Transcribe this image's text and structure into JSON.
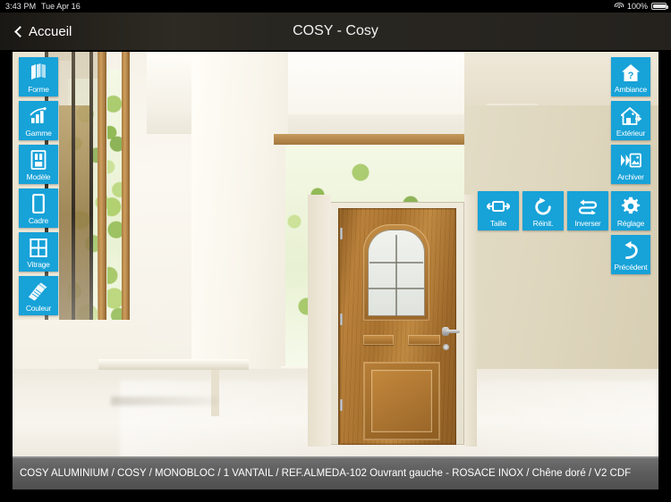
{
  "status_bar": {
    "time": "3:43 PM",
    "date": "Tue Apr 16",
    "battery_percent": "100%",
    "wifi_icon": "wifi-icon",
    "battery_icon": "battery-icon"
  },
  "nav_bar": {
    "back_label": "Accueil",
    "back_icon": "chevron-left-icon",
    "title": "COSY - Cosy"
  },
  "colors": {
    "accent": "#17a2d8",
    "navbar": "#3a372f",
    "infobar": "#5d5d5d"
  },
  "left_toolbar": [
    {
      "label": "Forme",
      "icon": "shapes-stack-icon"
    },
    {
      "label": "Gamme",
      "icon": "bar-chart-icon"
    },
    {
      "label": "Modèle",
      "icon": "door-model-icon"
    },
    {
      "label": "Cadre",
      "icon": "frame-icon"
    },
    {
      "label": "Vitrage",
      "icon": "window-grid-icon"
    },
    {
      "label": "Couleur",
      "icon": "paint-brush-icon"
    }
  ],
  "right_toolbar": [
    {
      "label": "Ambiance",
      "icon": "house-question-icon"
    },
    {
      "label": "Extérieur",
      "icon": "house-exterior-icon"
    },
    {
      "label": "Archiver",
      "icon": "archive-photo-icon"
    },
    {
      "label": "Réglage",
      "icon": "gear-icon"
    },
    {
      "label": "Précédent",
      "icon": "undo-arrow-icon"
    }
  ],
  "center_toolbar": [
    {
      "label": "Taille",
      "icon": "resize-horizontal-icon"
    },
    {
      "label": "Réinit.",
      "icon": "reset-circular-arrow-icon"
    },
    {
      "label": "Inverser",
      "icon": "flip-horizontal-icon"
    }
  ],
  "info_bar": {
    "text": "COSY ALUMINIUM / COSY / MONOBLOC / 1 VANTAIL / REF.ALMEDA-102 Ouvrant gauche - ROSACE INOX / Chêne doré / V2 CDF"
  },
  "preview": {
    "scene_description": "interior-hallway-with-door-preview",
    "door_name": "ALMEDA-102",
    "door_finish": "Chêne doré"
  }
}
